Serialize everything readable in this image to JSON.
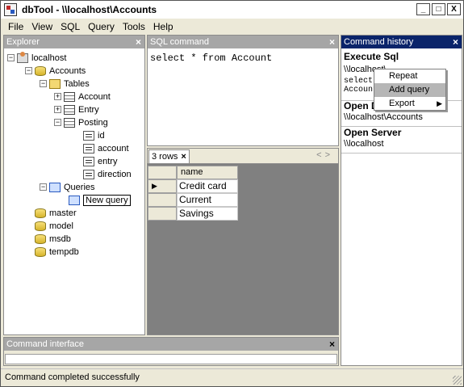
{
  "window": {
    "title": "dbTool - \\\\localhost\\Accounts",
    "minimize": "_",
    "maximize": "□",
    "close": "X"
  },
  "menu": [
    "File",
    "View",
    "SQL",
    "Query",
    "Tools",
    "Help"
  ],
  "explorer": {
    "title": "Explorer",
    "close": "×",
    "nodes": [
      {
        "label": "localhost",
        "icon": "server-icon",
        "expander": "−"
      },
      {
        "label": "Accounts",
        "icon": "database-icon",
        "expander": "−"
      },
      {
        "label": "Tables",
        "icon": "folder-icon",
        "expander": "−"
      },
      {
        "label": "Account",
        "icon": "table-icon",
        "expander": "+"
      },
      {
        "label": "Entry",
        "icon": "table-icon",
        "expander": "+"
      },
      {
        "label": "Posting",
        "icon": "table-icon",
        "expander": "−"
      },
      {
        "label": "id",
        "icon": "key-column-icon"
      },
      {
        "label": "account",
        "icon": "column-icon"
      },
      {
        "label": "entry",
        "icon": "column-icon"
      },
      {
        "label": "direction",
        "icon": "column-icon"
      },
      {
        "label": "Queries",
        "icon": "queries-folder-icon",
        "expander": "−"
      },
      {
        "label": "New query",
        "icon": "query-icon"
      },
      {
        "label": "master",
        "icon": "database-icon"
      },
      {
        "label": "model",
        "icon": "database-icon"
      },
      {
        "label": "msdb",
        "icon": "database-icon"
      },
      {
        "label": "tempdb",
        "icon": "database-icon"
      }
    ]
  },
  "sql": {
    "title": "SQL command",
    "close": "×",
    "text": "select * from Account"
  },
  "results": {
    "tab_label": "3 rows",
    "tab_close": "×",
    "nav_prev": "<",
    "nav_next": ">",
    "column": "name",
    "current_row_marker": "▶",
    "rows": [
      "Credit card",
      "Current",
      "Savings"
    ]
  },
  "history": {
    "title": "Command history",
    "close": "×",
    "entries": [
      {
        "heading": "Execute Sql",
        "line1": "\\\\localhost\\",
        "line2": "select",
        "line3": "Account"
      },
      {
        "heading": "Open D",
        "line1": "\\\\localhost\\Accounts"
      },
      {
        "heading": "Open Server",
        "line1": "\\\\localhost"
      }
    ]
  },
  "context_menu": {
    "items": [
      {
        "label": "Repeat"
      },
      {
        "label": "Add query"
      },
      {
        "label": "Export",
        "submenu_arrow": "▶"
      }
    ]
  },
  "command_interface": {
    "title": "Command interface",
    "close": "×",
    "value": ""
  },
  "status": {
    "text": "Command completed successfully"
  },
  "colors": {
    "active_header": "#0a246a",
    "inactive_header": "#a6a6a6",
    "results_bg": "#808080"
  }
}
